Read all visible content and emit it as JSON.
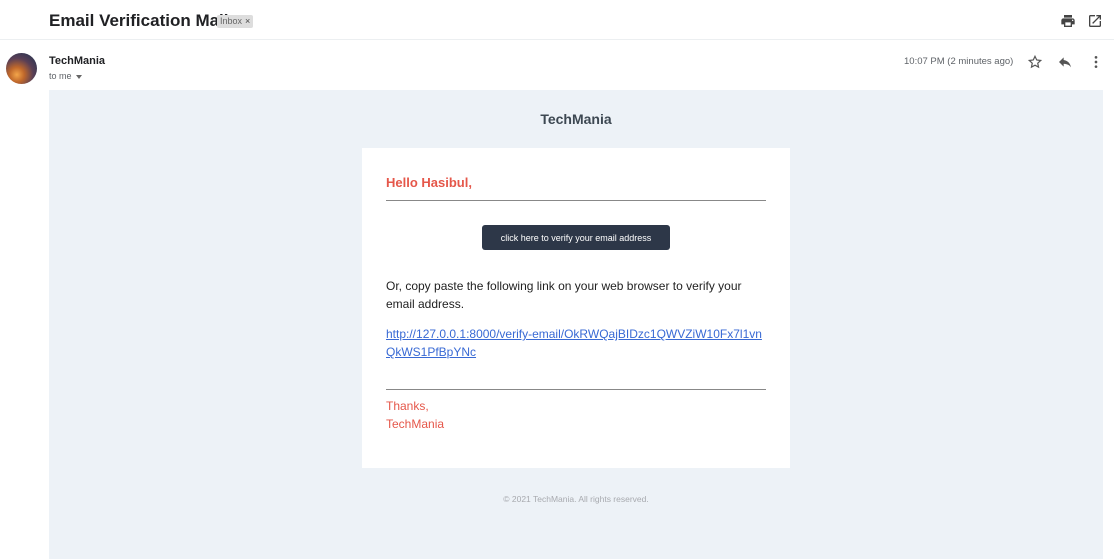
{
  "message": {
    "subject": "Email Verification Mail",
    "label": "Inbox",
    "label_remove": "×",
    "sender_name": "TechMania",
    "recipient": "to me",
    "timestamp": "10:07 PM (2 minutes ago)"
  },
  "icons": {
    "print": "print-icon",
    "new_window": "open-in-new-window-icon",
    "star": "star-icon",
    "reply": "reply-icon",
    "more": "more-vertical-icon",
    "recipient_details": "chevron-down-icon"
  },
  "email": {
    "brand": "TechMania",
    "greeting": "Hello Hasibul,",
    "button_label": "click here to verify your email address",
    "instructions": "Or, copy paste the following link on your web browser to verify your email address.",
    "link": "http://127.0.0.1:8000/verify-email/OkRWQajBIDzc1QWVZiW10Fx7l1vnQkWS1PfBpYNc",
    "thanks": "Thanks,",
    "signature": "TechMania",
    "footer": "© 2021 TechMania. All rights reserved."
  },
  "colors": {
    "accent_red": "#e5574a",
    "button_bg": "#2d3748",
    "link_blue": "#3869d4",
    "body_bg": "#edf2f7"
  }
}
